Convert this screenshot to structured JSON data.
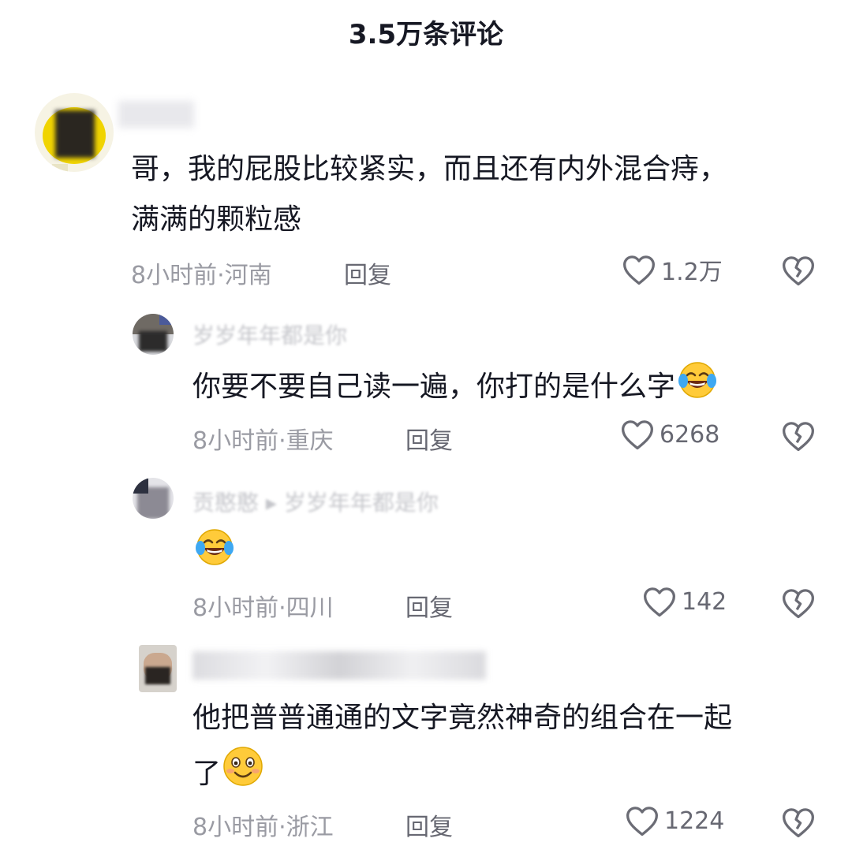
{
  "header": {
    "title": "3.5万条评论"
  },
  "comments": [
    {
      "text": "哥，我的屁股比较紧实，而且还有内外混合痔，",
      "text2": "满满的颗粒感",
      "meta": "8小时前·河南",
      "reply": "回复",
      "likes": "1.2万"
    },
    {
      "name": "岁岁年年都是你",
      "text": "你要不要自己读一遍，你打的是什么字",
      "meta": "8小时前·重庆",
      "reply": "回复",
      "likes": "6268"
    },
    {
      "name": "贡憨憨 ▸ 岁岁年年都是你",
      "meta": "8小时前·四川",
      "reply": "回复",
      "likes": "142"
    },
    {
      "name": "是……",
      "text": "他把普普通通的文字竟然神奇的组合在一起",
      "text2": "了",
      "meta": "8小时前·浙江",
      "reply": "回复",
      "likes": "1224"
    }
  ],
  "icons": {
    "like": "heart-outline-icon",
    "dislike": "broken-heart-icon",
    "emoji_laugh": "rolling-laughing-emoji",
    "emoji_smile": "smiling-emoji"
  }
}
